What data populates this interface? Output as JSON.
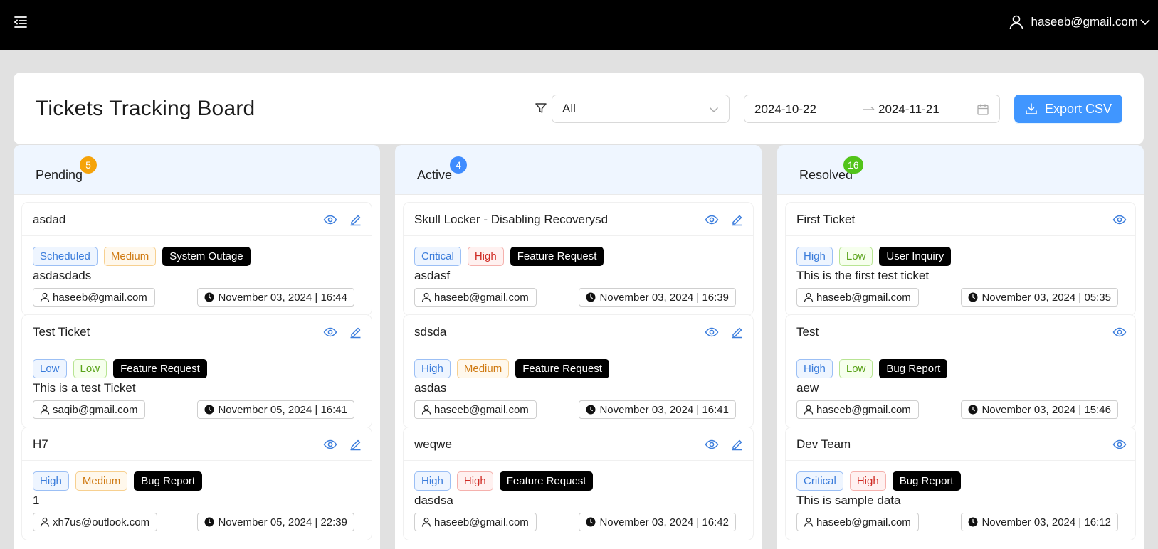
{
  "topbar": {
    "user_email": "haseeb@gmail.com"
  },
  "header": {
    "title": "Tickets Tracking Board",
    "filter_value": "All",
    "date_start": "2024-10-22",
    "date_end": "2024-11-21",
    "export_label": "Export CSV"
  },
  "colors": {
    "accent": "#4096ff",
    "pending_badge": "#f5a30a",
    "active_badge": "#3f8cff",
    "resolved_badge": "#52c41a"
  },
  "columns": [
    {
      "title": "Pending",
      "count": "5",
      "tickets": [
        {
          "title": "asdad",
          "tags": [
            "Scheduled",
            "Medium",
            "System Outage"
          ],
          "desc": "asdasdads",
          "user": "haseeb@gmail.com",
          "time": "November 03, 2024 | 16:44"
        },
        {
          "title": "Test Ticket",
          "tags": [
            "Low",
            "Low",
            "Feature Request"
          ],
          "desc": "This is a test Ticket",
          "user": "saqib@gmail.com",
          "time": "November 05, 2024 | 16:41"
        },
        {
          "title": "H7",
          "tags": [
            "High",
            "Medium",
            "Bug Report"
          ],
          "desc": "1",
          "user": "xh7us@outlook.com",
          "time": "November 05, 2024 | 22:39"
        }
      ]
    },
    {
      "title": "Active",
      "count": "4",
      "tickets": [
        {
          "title": "Skull Locker - Disabling Recoverysd",
          "tags": [
            "Critical",
            "High",
            "Feature Request"
          ],
          "desc": "asdasf",
          "user": "haseeb@gmail.com",
          "time": "November 03, 2024 | 16:39"
        },
        {
          "title": "sdsda",
          "tags": [
            "High",
            "Medium",
            "Feature Request"
          ],
          "desc": "asdas",
          "user": "haseeb@gmail.com",
          "time": "November 03, 2024 | 16:41"
        },
        {
          "title": "weqwe",
          "tags": [
            "High",
            "High",
            "Feature Request"
          ],
          "desc": "dasdsa",
          "user": "haseeb@gmail.com",
          "time": "November 03, 2024 | 16:42"
        }
      ]
    },
    {
      "title": "Resolved",
      "count": "16",
      "tickets": [
        {
          "title": "First Ticket",
          "tags": [
            "High",
            "Low",
            "User Inquiry"
          ],
          "desc": "This is the first test ticket",
          "user": "haseeb@gmail.com",
          "time": "November 03, 2024 | 05:35"
        },
        {
          "title": "Test",
          "tags": [
            "High",
            "Low",
            "Bug Report"
          ],
          "desc": "aew",
          "user": "haseeb@gmail.com",
          "time": "November 03, 2024 | 15:46"
        },
        {
          "title": "Dev Team",
          "tags": [
            "Critical",
            "High",
            "Bug Report"
          ],
          "desc": "This is sample data",
          "user": "haseeb@gmail.com",
          "time": "November 03, 2024 | 16:12"
        }
      ]
    }
  ]
}
